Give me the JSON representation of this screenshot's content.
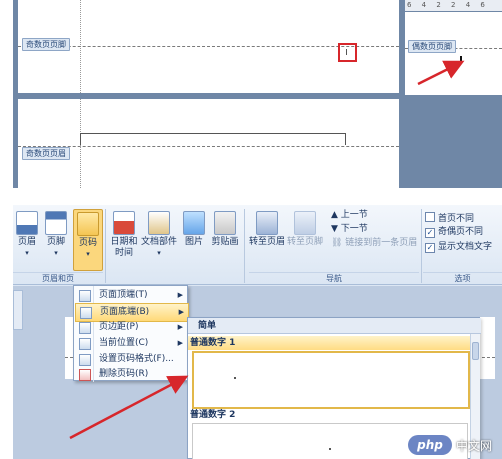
{
  "top": {
    "ruler_text": "6 4 2 2 4 6",
    "tag_odd_footer": "奇数页页脚",
    "tag_even_footer": "偶数页页脚",
    "tag_odd_header": "奇数页页眉"
  },
  "ribbon": {
    "header_label": "页眉",
    "footer_label": "页脚",
    "pagenum_label": "页码",
    "datetime_label": "日期和时间",
    "parts_label": "文档部件",
    "picture_label": "图片",
    "clipart_label": "剪贴画",
    "goto_header_label": "转至页眉",
    "goto_footer_label": "转至页脚",
    "prev_section_label": "上一节",
    "next_section_label": "下一节",
    "link_prev_label": "链接到前一条页眉",
    "diff_first_label": "首页不同",
    "diff_oddeven_label": "奇偶页不同",
    "show_text_label": "显示文档文字",
    "group_headerfooter": "页眉和页",
    "group_nav": "导航",
    "group_options": "选项",
    "diff_oddeven_checked": true,
    "show_text_checked": true,
    "diff_first_checked": false
  },
  "menu": {
    "items": [
      {
        "label": "页面顶端(T)"
      },
      {
        "label": "页面底端(B)"
      },
      {
        "label": "页边距(P)"
      },
      {
        "label": "当前位置(C)"
      },
      {
        "label": "设置页码格式(F)..."
      },
      {
        "label": "删除页码(R)"
      }
    ]
  },
  "gallery": {
    "header": "简单",
    "sections": [
      {
        "label": "普通数字 1"
      },
      {
        "label": "普通数字 2"
      }
    ]
  },
  "watermark": {
    "brand": "php",
    "site": "中文网"
  },
  "colors": {
    "accent_red": "#d7262b",
    "ribbon_blue": "#dbe6f3",
    "highlight": "#ffd978"
  }
}
